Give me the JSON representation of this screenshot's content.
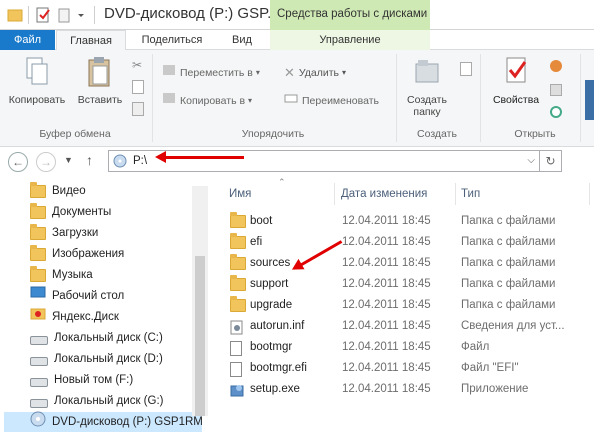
{
  "window": {
    "title": "DVD-дисковод (P:) GSP...",
    "context_tools": "Средства работы с дисками"
  },
  "tabs": {
    "file": "Файл",
    "home": "Главная",
    "share": "Поделиться",
    "view": "Вид",
    "manage": "Управление"
  },
  "ribbon": {
    "clipboard": {
      "copy": "Копировать",
      "paste": "Вставить",
      "group": "Буфер обмена"
    },
    "organize": {
      "move_to": "Переместить в",
      "copy_to": "Копировать в",
      "delete": "Удалить",
      "rename": "Переименовать",
      "group": "Упорядочить"
    },
    "new": {
      "new_folder_line1": "Создать",
      "new_folder_line2": "папку",
      "group": "Создать"
    },
    "open": {
      "properties": "Свойства",
      "group": "Открыть"
    }
  },
  "address": {
    "path": "P:\\"
  },
  "nav": {
    "items": [
      {
        "label": "Видео",
        "icon": "video-folder-icon"
      },
      {
        "label": "Документы",
        "icon": "documents-folder-icon"
      },
      {
        "label": "Загрузки",
        "icon": "downloads-folder-icon"
      },
      {
        "label": "Изображения",
        "icon": "pictures-folder-icon"
      },
      {
        "label": "Музыка",
        "icon": "music-folder-icon"
      },
      {
        "label": "Рабочий стол",
        "icon": "desktop-folder-icon"
      },
      {
        "label": "Яндекс.Диск",
        "icon": "yandex-disk-icon"
      },
      {
        "label": "Локальный диск (C:)",
        "icon": "drive-icon"
      },
      {
        "label": "Локальный диск (D:)",
        "icon": "drive-icon"
      },
      {
        "label": "Новый том (F:)",
        "icon": "drive-icon"
      },
      {
        "label": "Локальный диск (G:)",
        "icon": "drive-icon"
      },
      {
        "label": "DVD-дисковод (P:) GSP1RM",
        "icon": "dvd-drive-icon"
      }
    ]
  },
  "columns": {
    "name": "Имя",
    "date": "Дата изменения",
    "type": "Тип"
  },
  "files": [
    {
      "name": "boot",
      "date": "12.04.2011 18:45",
      "type": "Папка с файлами",
      "icon": "folder-icon"
    },
    {
      "name": "efi",
      "date": "12.04.2011 18:45",
      "type": "Папка с файлами",
      "icon": "folder-icon"
    },
    {
      "name": "sources",
      "date": "12.04.2011 18:45",
      "type": "Папка с файлами",
      "icon": "folder-icon"
    },
    {
      "name": "support",
      "date": "12.04.2011 18:45",
      "type": "Папка с файлами",
      "icon": "folder-icon"
    },
    {
      "name": "upgrade",
      "date": "12.04.2011 18:45",
      "type": "Папка с файлами",
      "icon": "folder-icon"
    },
    {
      "name": "autorun.inf",
      "date": "12.04.2011 18:45",
      "type": "Сведения для уст...",
      "icon": "settings-file-icon"
    },
    {
      "name": "bootmgr",
      "date": "12.04.2011 18:45",
      "type": "Файл",
      "icon": "file-icon"
    },
    {
      "name": "bootmgr.efi",
      "date": "12.04.2011 18:45",
      "type": "Файл \"EFI\"",
      "icon": "file-icon"
    },
    {
      "name": "setup.exe",
      "date": "12.04.2011 18:45",
      "type": "Приложение",
      "icon": "setup-app-icon"
    }
  ]
}
